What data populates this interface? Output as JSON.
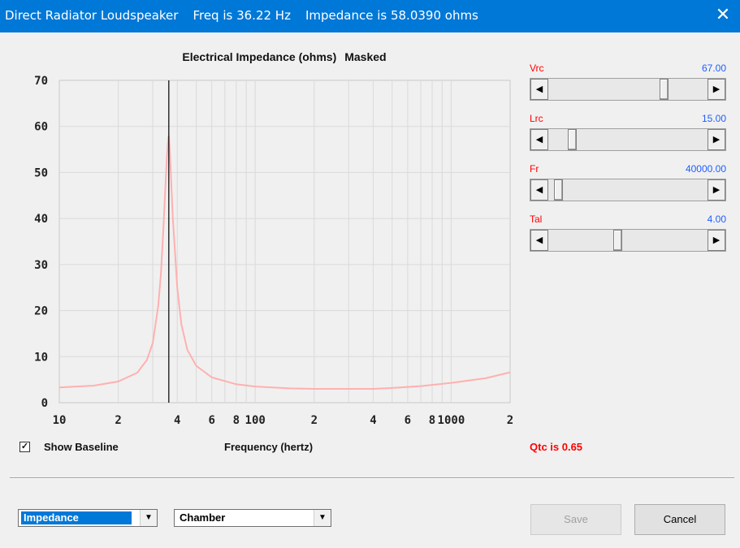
{
  "window": {
    "app_title": "Direct Radiator Loudspeaker",
    "freq_text": "Freq is 36.22 Hz",
    "impedance_text": "Impedance is 58.0390 ohms"
  },
  "chart": {
    "title": "Electrical Impedance (ohms)",
    "mask_label": "Masked",
    "xlabel": "Frequency (hertz)"
  },
  "chart_data": {
    "type": "line",
    "title": "Electrical Impedance (ohms)  Masked",
    "xlabel": "Frequency (hertz)",
    "ylabel": "",
    "x_scale": "log",
    "xlim": [
      10,
      2000
    ],
    "ylim": [
      0,
      70
    ],
    "y_ticks": [
      "0",
      "10",
      "20",
      "30",
      "40",
      "50",
      "60",
      "70"
    ],
    "x_ticks": [
      "10",
      "2",
      "4",
      "6",
      "8",
      "100",
      "2",
      "4",
      "6",
      "8",
      "1000",
      "2"
    ],
    "x_tick_values": [
      10,
      20,
      40,
      60,
      80,
      100,
      200,
      400,
      600,
      800,
      1000,
      2000
    ],
    "grid": true,
    "cursor_x": 36.22,
    "series": [
      {
        "color": "#ffb0b0",
        "x": [
          10,
          15,
          20,
          25,
          28,
          30,
          32,
          33,
          34,
          35,
          35.5,
          36,
          36.22,
          36.5,
          37,
          38,
          40,
          42,
          45,
          50,
          60,
          80,
          100,
          150,
          200,
          300,
          400,
          500,
          700,
          1000,
          1500,
          2000
        ],
        "y": [
          3.3,
          3.7,
          4.6,
          6.5,
          9.3,
          13,
          21,
          28,
          38,
          49,
          54,
          57.5,
          58.0,
          56,
          51,
          40,
          25,
          17,
          11.5,
          8,
          5.5,
          4,
          3.5,
          3.1,
          3.0,
          3.0,
          3.0,
          3.2,
          3.6,
          4.3,
          5.3,
          6.6
        ]
      }
    ]
  },
  "options": {
    "show_baseline_label": "Show Baseline",
    "show_baseline_checked": true,
    "qtc_text": "Qtc is 0.65"
  },
  "sliders": [
    {
      "label": "Vrc",
      "value": "67.00",
      "position": 0.74
    },
    {
      "label": "Lrc",
      "value": "15.00",
      "position": 0.13
    },
    {
      "label": "Fr",
      "value": "40000.00",
      "position": 0.04
    },
    {
      "label": "Tal",
      "value": "4.00",
      "position": 0.43
    }
  ],
  "bottom": {
    "plot_select": "Impedance",
    "enclosure_select": "Chamber",
    "save_label": "Save",
    "cancel_label": "Cancel"
  },
  "colors": {
    "title_bar": "#0078d7",
    "curve": "#ffb0b0",
    "slider_label": "#ff0000",
    "slider_value": "#1e5eff",
    "qtc": "#ff0000"
  }
}
